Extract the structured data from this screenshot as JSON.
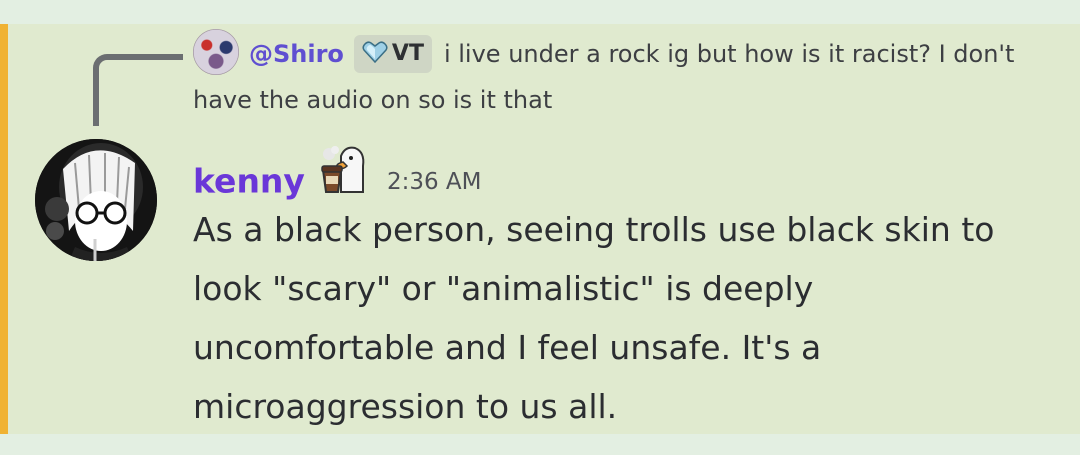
{
  "reply": {
    "username": "@Shiro",
    "tag": "VT",
    "text": "i live under a rock ig but how is it racist? I don't have the audio on so is it that"
  },
  "message": {
    "author": "kenny",
    "timestamp": "2:36 AM",
    "content": "As a black person, seeing trolls use black skin to look \"scary\" or \"animalistic\" is deeply uncomfortable and I feel unsafe. It's a microaggression to us all."
  },
  "colors": {
    "mention_bar": "#f0b232",
    "message_bg": "#e0eacf",
    "page_bg": "#e3efe2",
    "reply_name": "#5f4fd1",
    "author_name": "#6a37d8"
  },
  "icons": {
    "reply_avatar": "anime-avatar",
    "tag_icon": "heart-gem-icon",
    "role_icon": "duck-coffee-icon",
    "main_avatar": "manga-girl-avatar"
  }
}
